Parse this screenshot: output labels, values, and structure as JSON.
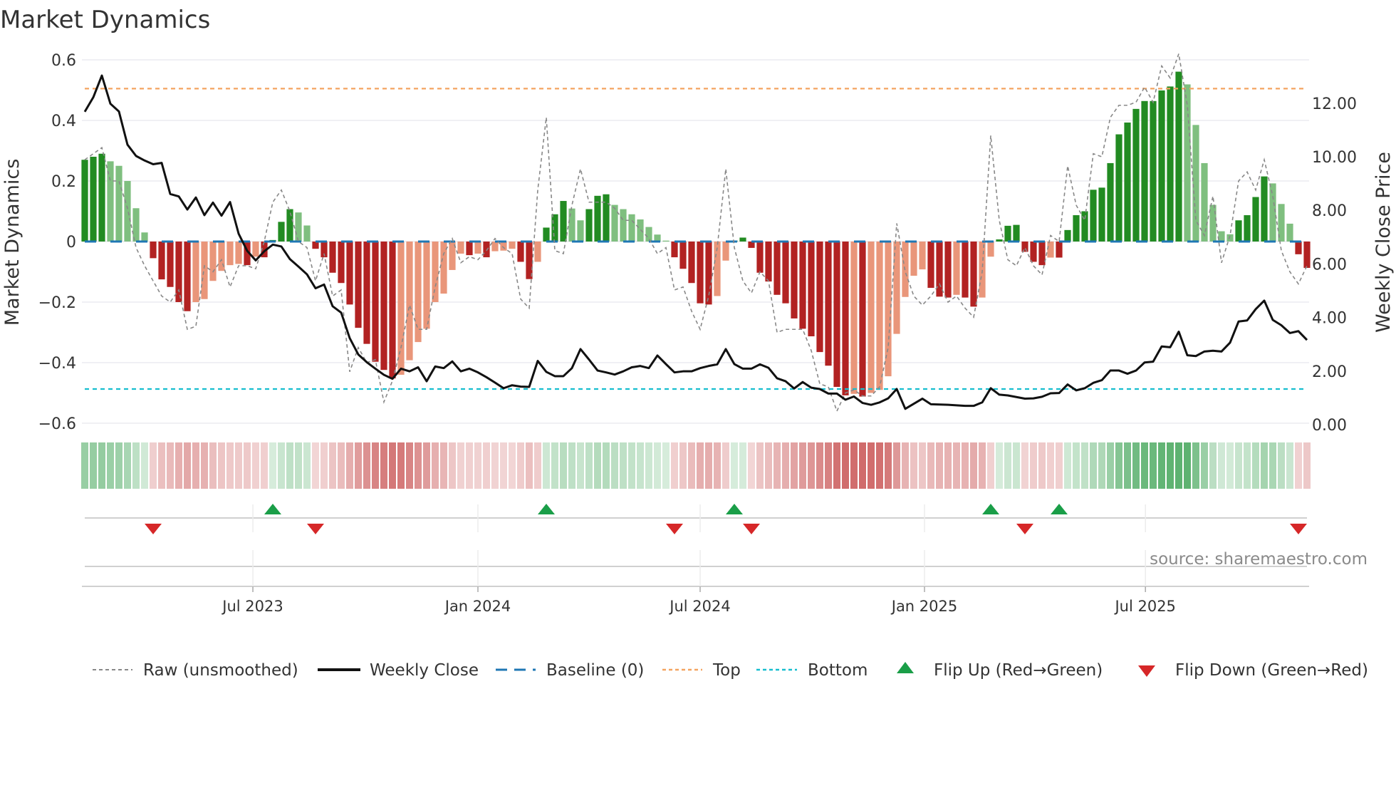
{
  "chart_data": {
    "type": "bar",
    "title": "Market Dynamics",
    "ylabel": "Market Dynamics",
    "ylabel_right": "Weekly Close Price",
    "ylim": [
      -0.6,
      0.6
    ],
    "ylim_right": [
      0,
      13.5
    ],
    "left_ticks": [
      "0.6",
      "0.4",
      "0.2",
      "0",
      "−0.2",
      "−0.4",
      "−0.6"
    ],
    "left_tick_values": [
      0.6,
      0.4,
      0.2,
      0,
      -0.2,
      -0.4,
      -0.6
    ],
    "right_ticks": [
      "0.00",
      "2.00",
      "4.00",
      "6.00",
      "8.00",
      "10.00",
      "12.00"
    ],
    "right_tick_values": [
      0,
      2,
      4,
      6,
      8,
      10,
      12
    ],
    "x_ticks": [
      {
        "label": "Jul 2023",
        "week": 19.67
      },
      {
        "label": "Jan 2024",
        "week": 46.0
      },
      {
        "label": "Jul 2024",
        "week": 72.0
      },
      {
        "label": "Jan 2025",
        "week": 98.25
      },
      {
        "label": "Jul 2025",
        "week": 124.1
      }
    ],
    "top_level": 0.505,
    "bottom_level": -0.487,
    "baseline": 0,
    "smoothed": [
      0.27,
      0.28,
      0.29,
      0.265,
      0.25,
      0.2,
      0.11,
      0.03,
      -0.055,
      -0.125,
      -0.15,
      -0.2,
      -0.23,
      -0.2,
      -0.19,
      -0.13,
      -0.097,
      -0.078,
      -0.074,
      -0.078,
      -0.05,
      -0.052,
      0.005,
      0.065,
      0.107,
      0.096,
      0.053,
      -0.024,
      -0.052,
      -0.103,
      -0.137,
      -0.208,
      -0.285,
      -0.338,
      -0.397,
      -0.424,
      -0.452,
      -0.44,
      -0.392,
      -0.332,
      -0.288,
      -0.2,
      -0.172,
      -0.094,
      -0.04,
      -0.045,
      -0.04,
      -0.052,
      -0.032,
      -0.03,
      -0.024,
      -0.067,
      -0.124,
      -0.067,
      0.046,
      0.09,
      0.134,
      0.109,
      0.07,
      0.107,
      0.151,
      0.156,
      0.121,
      0.107,
      0.09,
      0.073,
      0.048,
      0.023,
      0.003,
      -0.052,
      -0.09,
      -0.137,
      -0.204,
      -0.208,
      -0.18,
      -0.063,
      0.003,
      0.013,
      -0.021,
      -0.103,
      -0.132,
      -0.176,
      -0.204,
      -0.254,
      -0.288,
      -0.313,
      -0.365,
      -0.41,
      -0.48,
      -0.508,
      -0.503,
      -0.512,
      -0.5,
      -0.49,
      -0.445,
      -0.305,
      -0.183,
      -0.113,
      -0.092,
      -0.153,
      -0.182,
      -0.185,
      -0.176,
      -0.185,
      -0.215,
      -0.185,
      -0.05,
      0.007,
      0.052,
      0.055,
      -0.034,
      -0.067,
      -0.078,
      -0.053,
      -0.053,
      0.038,
      0.087,
      0.1,
      0.171,
      0.178,
      0.259,
      0.354,
      0.393,
      0.438,
      0.464,
      0.464,
      0.499,
      0.512,
      0.561,
      0.519,
      0.385,
      0.259,
      0.121,
      0.034,
      0.024,
      0.07,
      0.087,
      0.147,
      0.215,
      0.192,
      0.124,
      0.059,
      -0.042,
      -0.087
    ],
    "raw": [
      0.27,
      0.29,
      0.31,
      0.2,
      0.2,
      0.11,
      -0.02,
      -0.08,
      -0.13,
      -0.18,
      -0.2,
      -0.16,
      -0.29,
      -0.28,
      -0.08,
      -0.1,
      -0.06,
      -0.15,
      -0.08,
      -0.08,
      -0.09,
      0,
      0.13,
      0.17,
      0.1,
      0,
      -0.02,
      -0.13,
      -0.04,
      -0.18,
      -0.16,
      -0.43,
      -0.35,
      -0.4,
      -0.39,
      -0.53,
      -0.46,
      -0.35,
      -0.21,
      -0.29,
      -0.29,
      -0.15,
      -0.04,
      0.01,
      -0.07,
      -0.05,
      -0.06,
      -0.03,
      0.01,
      -0.02,
      -0.04,
      -0.19,
      -0.22,
      0.17,
      0.41,
      -0.03,
      -0.04,
      0.12,
      0.24,
      0.13,
      0.13,
      0.13,
      0.11,
      0.07,
      0.07,
      0.04,
      0.01,
      -0.04,
      -0.02,
      -0.16,
      -0.15,
      -0.23,
      -0.29,
      -0.18,
      -0.02,
      0.24,
      -0.02,
      -0.13,
      -0.17,
      -0.1,
      -0.13,
      -0.3,
      -0.29,
      -0.29,
      -0.29,
      -0.36,
      -0.47,
      -0.48,
      -0.56,
      -0.5,
      -0.49,
      -0.51,
      -0.51,
      -0.48,
      -0.35,
      0.06,
      -0.1,
      -0.18,
      -0.21,
      -0.18,
      -0.14,
      -0.2,
      -0.18,
      -0.22,
      -0.25,
      -0.1,
      0.35,
      0.07,
      -0.06,
      -0.08,
      -0.02,
      -0.08,
      -0.11,
      0.02,
      0,
      0.25,
      0.12,
      0.07,
      0.29,
      0.28,
      0.41,
      0.45,
      0.45,
      0.46,
      0.51,
      0.46,
      0.58,
      0.54,
      0.62,
      0.45,
      0.07,
      0.02,
      0.15,
      -0.07,
      0.02,
      0.2,
      0.23,
      0.17,
      0.27,
      0.15,
      -0.03,
      -0.1,
      -0.14,
      -0.08
    ],
    "weekly_close": [
      11.68,
      12.22,
      13.03,
      11.98,
      11.69,
      10.45,
      10.03,
      9.86,
      9.72,
      9.77,
      8.61,
      8.52,
      8.03,
      8.48,
      7.82,
      8.29,
      7.8,
      8.31,
      7.13,
      6.49,
      6.13,
      6.47,
      6.72,
      6.65,
      6.18,
      5.9,
      5.61,
      5.09,
      5.23,
      4.42,
      4.18,
      3.23,
      2.62,
      2.33,
      2.09,
      1.86,
      1.71,
      2.09,
      1.99,
      2.14,
      1.62,
      2.17,
      2.11,
      2.36,
      1.99,
      2.09,
      1.95,
      1.77,
      1.57,
      1.36,
      1.47,
      1.42,
      1.41,
      2.38,
      1.97,
      1.81,
      1.81,
      2.11,
      2.82,
      2.43,
      2.02,
      1.95,
      1.87,
      1.99,
      2.14,
      2.19,
      2.11,
      2.58,
      2.26,
      1.95,
      1.99,
      1.99,
      2.11,
      2.19,
      2.25,
      2.82,
      2.26,
      2.09,
      2.09,
      2.25,
      2.12,
      1.73,
      1.62,
      1.35,
      1.59,
      1.38,
      1.33,
      1.16,
      1.16,
      0.93,
      1.05,
      0.81,
      0.74,
      0.83,
      0.98,
      1.33,
      0.59,
      0.78,
      0.97,
      0.76,
      0.75,
      0.74,
      0.72,
      0.7,
      0.7,
      0.83,
      1.36,
      1.12,
      1.09,
      1.03,
      0.97,
      0.98,
      1.04,
      1.17,
      1.18,
      1.5,
      1.28,
      1.36,
      1.56,
      1.66,
      2.02,
      2.02,
      1.9,
      2.02,
      2.32,
      2.35,
      2.92,
      2.89,
      3.47,
      2.59,
      2.56,
      2.73,
      2.76,
      2.73,
      3.06,
      3.85,
      3.89,
      4.31,
      4.63,
      3.91,
      3.71,
      3.42,
      3.49,
      3.16
    ],
    "flip_up_weeks": [
      23,
      55,
      77,
      107,
      115
    ],
    "flip_down_weeks": [
      9,
      28,
      70,
      79,
      111,
      143
    ],
    "legend": {
      "placement": "bottom",
      "raw": "Raw (unsmoothed)",
      "close": "Weekly Close",
      "baseline": "Baseline (0)",
      "top": "Top",
      "bottom": "Bottom",
      "flip_up": "Flip Up (Red→Green)",
      "flip_down": "Flip Down (Green→Red)"
    },
    "source": "source: sharemaestro.com",
    "colors": {
      "pos_strong": "#228b22",
      "pos_weak": "#7fbf7f",
      "neg_strong": "#b22222",
      "neg_weak": "#e9967a",
      "close": "#111111",
      "raw": "#888888",
      "baseline": "#1f77b4",
      "top": "#f4a460",
      "bottom": "#17becf",
      "flip_up": "#1a9e48",
      "flip_down": "#d62728"
    }
  }
}
